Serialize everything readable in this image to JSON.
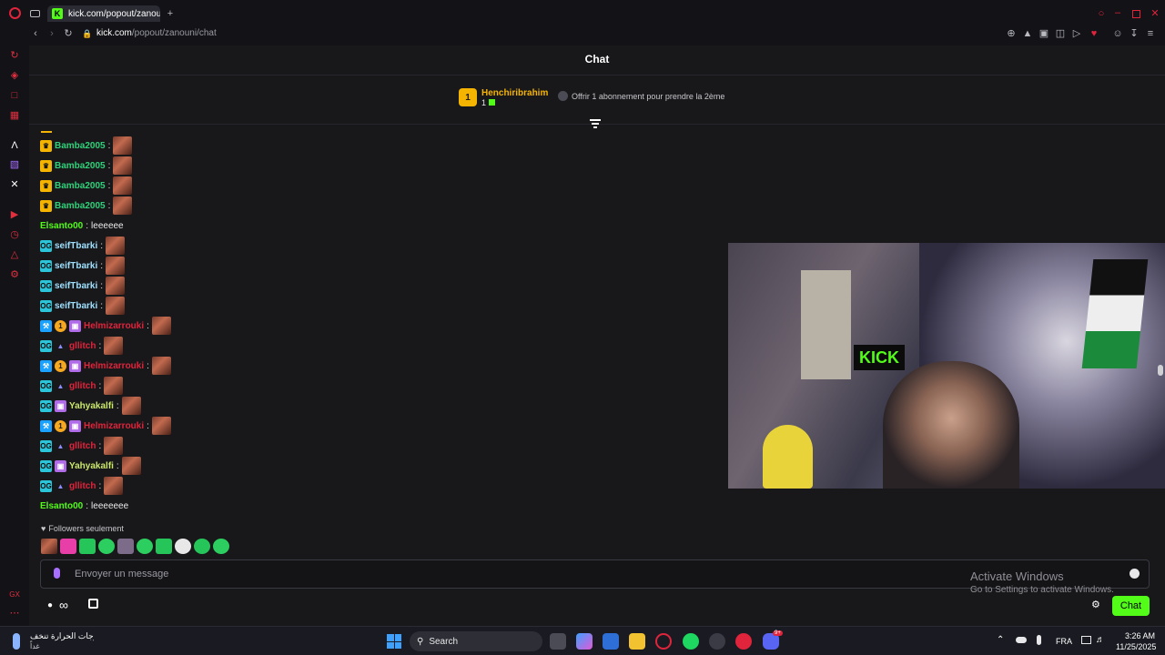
{
  "browser": {
    "tab_title": "kick.com/popout/zanouni",
    "url_host": "kick.com",
    "url_path": "/popout/zanouni/chat",
    "new_tab": "+"
  },
  "chat": {
    "title": "Chat",
    "pinned_user": "Henchiribrahim",
    "pinned_rank": "1",
    "pinned_count": "1",
    "gift_prompt": "Offrir 1 abonnement pour prendre la 2ème",
    "messages": [
      {
        "user": "Bamba2005",
        "color": "#30d17a",
        "badges": [
          "crown"
        ],
        "text": "",
        "emote": true
      },
      {
        "user": "Bamba2005",
        "color": "#30d17a",
        "badges": [
          "crown"
        ],
        "text": "",
        "emote": true
      },
      {
        "user": "Bamba2005",
        "color": "#30d17a",
        "badges": [
          "crown"
        ],
        "text": "",
        "emote": true
      },
      {
        "user": "Bamba2005",
        "color": "#30d17a",
        "badges": [
          "crown"
        ],
        "text": "",
        "emote": true
      },
      {
        "user": "Elsanto00",
        "color": "#53fc18",
        "badges": [],
        "text": "leeeeee",
        "emote": false
      },
      {
        "user": "seifTbarki",
        "color": "#9fe0ff",
        "badges": [
          "og"
        ],
        "text": "",
        "emote": true
      },
      {
        "user": "seifTbarki",
        "color": "#9fe0ff",
        "badges": [
          "og"
        ],
        "text": "",
        "emote": true
      },
      {
        "user": "seifTbarki",
        "color": "#9fe0ff",
        "badges": [
          "og"
        ],
        "text": "",
        "emote": true
      },
      {
        "user": "seifTbarki",
        "color": "#9fe0ff",
        "badges": [
          "og"
        ],
        "text": "",
        "emote": true
      },
      {
        "user": "Helmizarrouki",
        "color": "#e0243b",
        "badges": [
          "mod",
          "sub",
          "gift"
        ],
        "text": "",
        "emote": true
      },
      {
        "user": "gllitch",
        "color": "#e0243b",
        "badges": [
          "og",
          "verified"
        ],
        "text": "",
        "emote": true
      },
      {
        "user": "Helmizarrouki",
        "color": "#e0243b",
        "badges": [
          "mod",
          "sub",
          "gift"
        ],
        "text": "",
        "emote": true
      },
      {
        "user": "gllitch",
        "color": "#e0243b",
        "badges": [
          "og",
          "verified"
        ],
        "text": "",
        "emote": true
      },
      {
        "user": "Yahyakalfi",
        "color": "#cbe86b",
        "badges": [
          "og",
          "gift"
        ],
        "text": "",
        "emote": true
      },
      {
        "user": "Helmizarrouki",
        "color": "#e0243b",
        "badges": [
          "mod",
          "sub",
          "gift"
        ],
        "text": "",
        "emote": true
      },
      {
        "user": "gllitch",
        "color": "#e0243b",
        "badges": [
          "og",
          "verified"
        ],
        "text": "",
        "emote": true
      },
      {
        "user": "Yahyakalfi",
        "color": "#cbe86b",
        "badges": [
          "og",
          "gift"
        ],
        "text": "",
        "emote": true
      },
      {
        "user": "gllitch",
        "color": "#e0243b",
        "badges": [
          "og",
          "verified"
        ],
        "text": "",
        "emote": true
      },
      {
        "user": "Elsanto00",
        "color": "#53fc18",
        "badges": [],
        "text": "leeeeeee",
        "emote": false
      }
    ],
    "followers_only": "Followers seulement",
    "input_placeholder": "Envoyer un message",
    "send_label": "Chat",
    "watermark_line1": "Activate Windows",
    "watermark_line2": "Go to Settings to activate Windows."
  },
  "taskbar": {
    "search_label": "Search",
    "weather_text": "درجات الحرارة تنخف...",
    "weather_sub": "غداً",
    "language": "FRA",
    "time": "3:26 AM",
    "date": "11/25/2025",
    "discord_badge": "9+"
  },
  "sidebar_bottom": "GX"
}
